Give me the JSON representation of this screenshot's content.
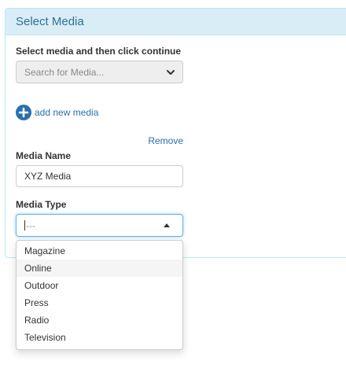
{
  "panel": {
    "title": "Select Media"
  },
  "select_media": {
    "label": "Select media and then click continue",
    "placeholder": "Search for Media..."
  },
  "add_media": {
    "label": "add new media"
  },
  "remove": {
    "label": "Remove"
  },
  "media_name": {
    "label": "Media Name",
    "value": "XYZ Media"
  },
  "media_type": {
    "label": "Media Type",
    "value": "---",
    "options": [
      "Magazine",
      "Online",
      "Outdoor",
      "Press",
      "Radio",
      "Television"
    ],
    "highlighted": "Online"
  },
  "colors": {
    "panel_heading_bg": "#d9edf7",
    "panel_title": "#31708f",
    "link": "#2a6fae",
    "focus_border": "#66afe9"
  }
}
